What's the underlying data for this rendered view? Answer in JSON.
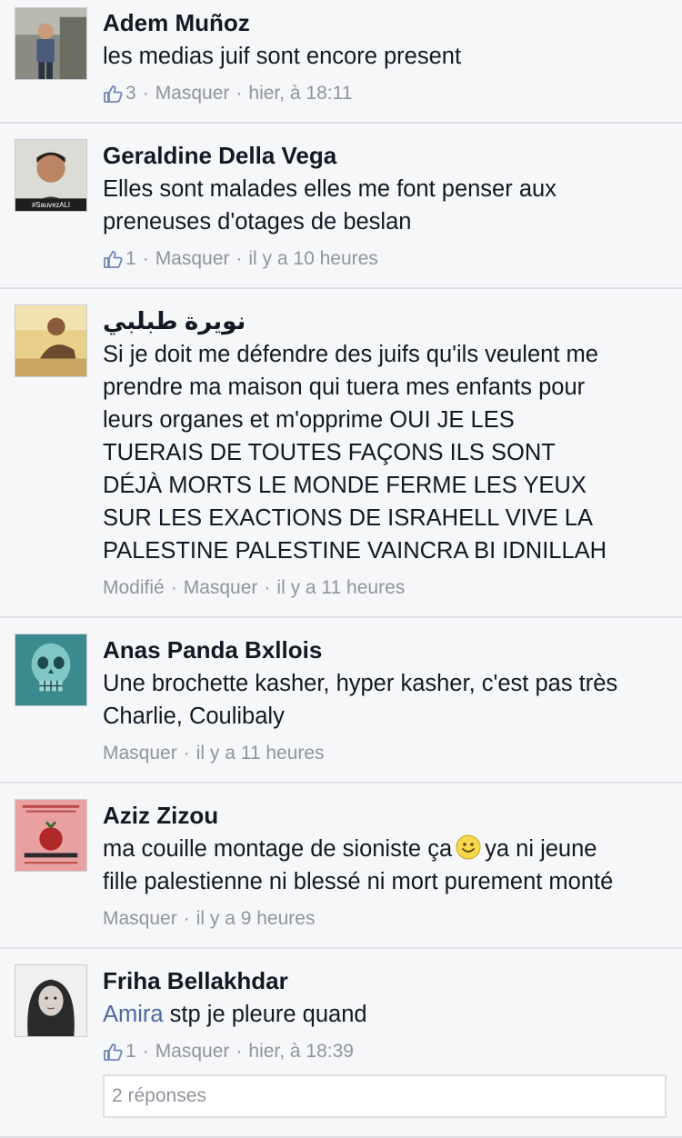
{
  "comments": [
    {
      "author": "Adem Muñoz",
      "lines": [
        "les medias juif sont encore present"
      ],
      "likes": "3",
      "hide": "Masquer",
      "time": "hier, à 18:11"
    },
    {
      "author": "Geraldine Della Vega",
      "avatar_badge": "#SauvezALI",
      "lines": [
        "Elles sont malades elles me font penser aux",
        "preneuses d'otages de beslan"
      ],
      "likes": "1",
      "hide": "Masquer",
      "time": "il y a 10 heures"
    },
    {
      "author": "نويرة طبلبي",
      "lines": [
        "Si je doit me défendre des juifs qu'ils veulent me",
        "prendre ma maison qui tuera mes enfants pour",
        "leurs organes et m'opprime OUI JE LES",
        "TUERAIS DE TOUTES FAÇONS ILS SONT",
        "DÉJÀ MORTS LE MONDE FERME LES YEUX",
        "SUR LES EXACTIONS DE ISRAHELL VIVE LA",
        "PALESTINE PALESTINE VAINCRA BI IDNILLAH"
      ],
      "edited": "Modifié",
      "hide": "Masquer",
      "time": "il y a 11 heures"
    },
    {
      "author": "Anas Panda Bxllois",
      "lines": [
        "Une brochette kasher, hyper kasher, c'est pas très",
        "Charlie, Coulibaly"
      ],
      "hide": "Masquer",
      "time": "il y a 11 heures"
    },
    {
      "author": "Aziz Zizou",
      "line1_before": "ma couille montage de sioniste ça",
      "line1_after": "ya ni jeune",
      "line2": "fille palestienne ni blessé ni mort purement monté",
      "hide": "Masquer",
      "time": "il y a 9 heures"
    },
    {
      "author": "Friha Bellakhdar",
      "mention": "Amira",
      "text": " stp je pleure quand",
      "likes": "1",
      "hide": "Masquer",
      "time": "hier, à 18:39"
    }
  ],
  "replies_label": "2 réponses",
  "separator": "·",
  "colors": {
    "background": "#f6f7f9",
    "text": "#141823",
    "meta": "#90949c",
    "link": "#4e69a2",
    "divider": "#dfe1e6"
  },
  "icons": {
    "like": "thumbs-up-icon",
    "emoji": "smiley-icon"
  }
}
